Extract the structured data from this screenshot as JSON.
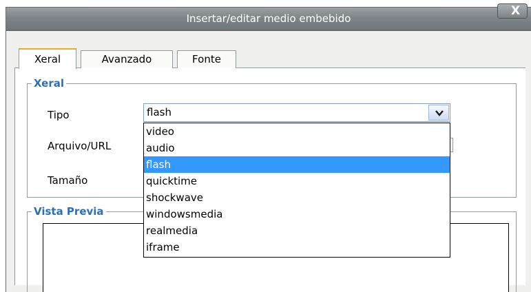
{
  "window": {
    "title": "Insertar/editar medio embebido",
    "close_label": "X"
  },
  "tabs": [
    {
      "label": "Xeral",
      "active": true
    },
    {
      "label": "Avanzado",
      "active": false
    },
    {
      "label": "Fonte",
      "active": false
    }
  ],
  "general": {
    "legend": "Xeral",
    "type_label": "Tipo",
    "url_label": "Arquivo/URL",
    "size_label": "Tamaño",
    "type_select": {
      "value": "flash",
      "options": [
        "video",
        "audio",
        "flash",
        "quicktime",
        "shockwave",
        "windowsmedia",
        "realmedia",
        "iframe"
      ],
      "highlighted": "flash"
    }
  },
  "preview": {
    "legend": "Vista Previa"
  },
  "icons": {
    "dropdown_arrow": "chevron-down-icon",
    "close": "close-icon"
  },
  "colors": {
    "accent": "#2b6fb6",
    "selection": "#3399ff",
    "tab_highlight": "#f5a623",
    "titlebar": "#7f868a"
  }
}
